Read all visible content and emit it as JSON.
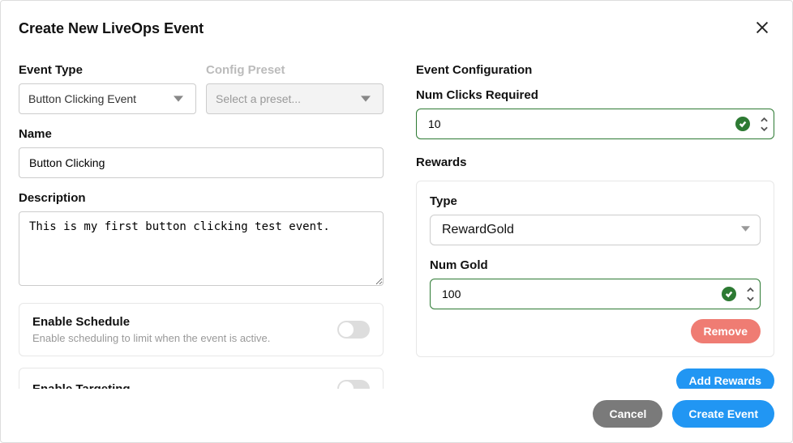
{
  "modal": {
    "title": "Create New LiveOps Event"
  },
  "left": {
    "eventType": {
      "label": "Event Type",
      "value": "Button Clicking Event"
    },
    "configPreset": {
      "label": "Config Preset",
      "placeholder": "Select a preset..."
    },
    "name": {
      "label": "Name",
      "value": "Button Clicking"
    },
    "description": {
      "label": "Description",
      "value": "This is my first button clicking test event."
    },
    "schedule": {
      "title": "Enable Schedule",
      "sub": "Enable scheduling to limit when the event is active.",
      "on": false
    },
    "targeting": {
      "title": "Enable Targeting",
      "on": false
    }
  },
  "right": {
    "heading": "Event Configuration",
    "numClicks": {
      "label": "Num Clicks Required",
      "value": "10"
    },
    "rewards": {
      "heading": "Rewards",
      "type": {
        "label": "Type",
        "value": "RewardGold"
      },
      "numGold": {
        "label": "Num Gold",
        "value": "100"
      },
      "remove": "Remove"
    },
    "addRewards": "Add Rewards"
  },
  "footer": {
    "cancel": "Cancel",
    "create": "Create Event"
  }
}
